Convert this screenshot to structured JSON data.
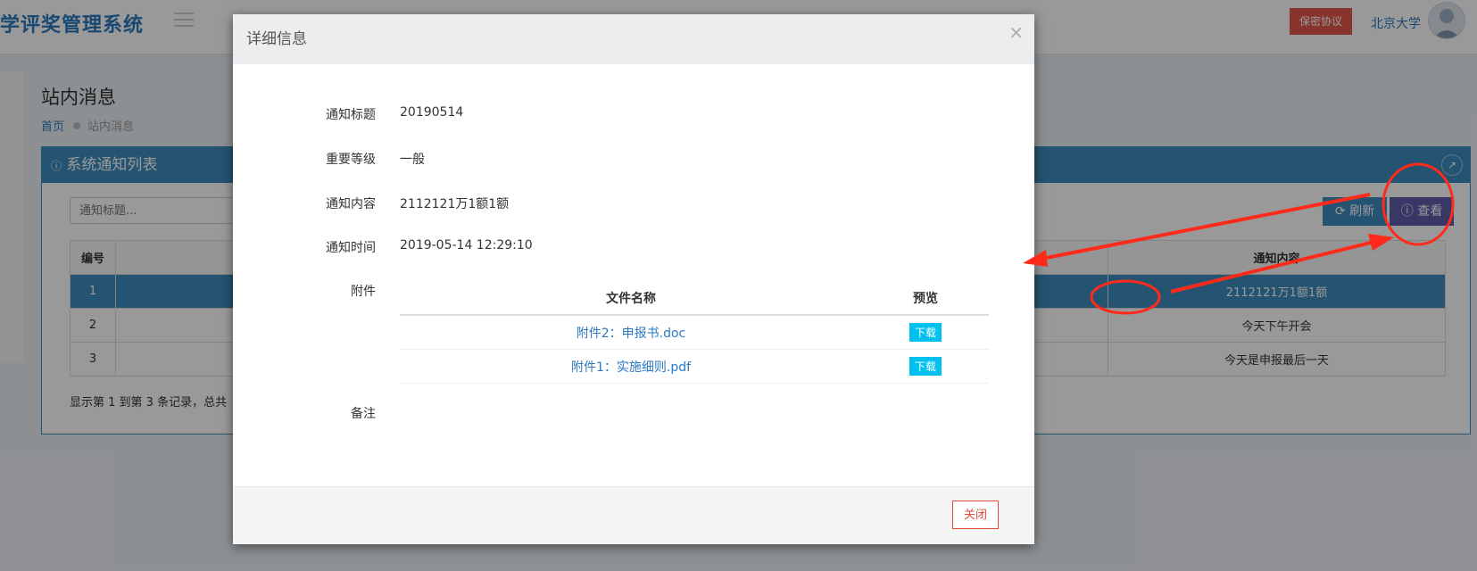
{
  "header": {
    "app_title": "学评奖管理系统",
    "secret_label": "保密协议",
    "school": "北京大学"
  },
  "page": {
    "title": "站内消息",
    "breadcrumb_home": "首页",
    "breadcrumb_current": "站内消息"
  },
  "panel": {
    "title": "系统通知列表",
    "search_placeholder": "通知标题...",
    "refresh_label": "刷新",
    "view_label": "查看",
    "columns": [
      "编号",
      "通知内容"
    ],
    "rows": [
      {
        "id": "1",
        "content": "2112121万1额1额"
      },
      {
        "id": "2",
        "content": "今天下午开会"
      },
      {
        "id": "3",
        "content": "今天是申报最后一天"
      }
    ],
    "pager_text": "显示第 1 到第 3 条记录，总共"
  },
  "modal": {
    "title": "详细信息",
    "fields": [
      {
        "label": "通知标题",
        "value": "20190514"
      },
      {
        "label": "重要等级",
        "value": "一般"
      },
      {
        "label": "通知内容",
        "value": "2112121万1额1额"
      },
      {
        "label": "通知时间",
        "value": "2019-05-14 12:29:10"
      }
    ],
    "attachment_label": "附件",
    "file_columns": [
      "文件名称",
      "预览"
    ],
    "files": [
      {
        "name": "附件2：申报书.doc",
        "action": "下载"
      },
      {
        "name": "附件1：实施细则.pdf",
        "action": "下载"
      }
    ],
    "remark_label": "备注",
    "close_label": "关闭"
  },
  "colors": {
    "primary": "#3c8dbc",
    "title_blue": "#2b79bf",
    "danger": "#e2574c",
    "view_purple": "#605ca8",
    "info": "#00c0ef",
    "annotation_red": "#ff2a1a"
  }
}
